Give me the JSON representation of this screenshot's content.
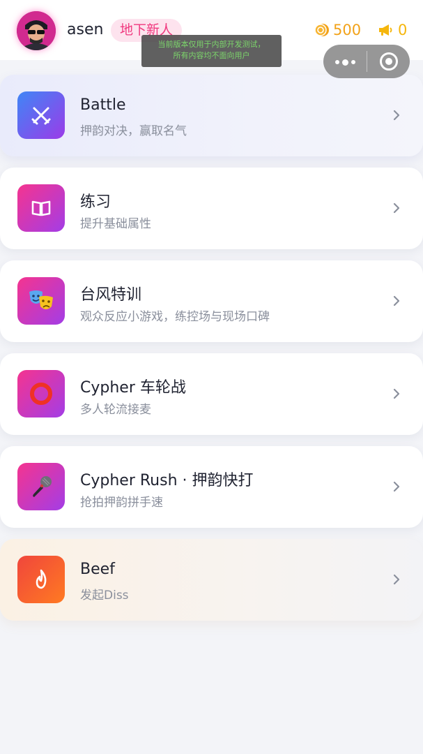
{
  "header": {
    "username": "asen",
    "rank_badge": "地下新人",
    "coins": "500",
    "notifications": "0"
  },
  "dev_notice": {
    "line1": "当前版本仅用于内部开发测试，",
    "line2": "所有内容均不面向用户"
  },
  "menu": [
    {
      "title": "Battle",
      "subtitle": "押韵对决，赢取名气",
      "icon": "crossed-swords-icon",
      "gradient": [
        "#3f86f6",
        "#9b3be8"
      ]
    },
    {
      "title": "练习",
      "subtitle": "提升基础属性",
      "icon": "open-book-icon",
      "gradient": [
        "#f5348f",
        "#a33de6"
      ]
    },
    {
      "title": "台风特训",
      "subtitle": "观众反应小游戏，练控场与现场口碑",
      "icon": "theater-masks-icon",
      "gradient": [
        "#f5348f",
        "#a33de6"
      ]
    },
    {
      "title": "Cypher 车轮战",
      "subtitle": "多人轮流接麦",
      "icon": "red-circle-icon",
      "gradient": [
        "#f5348f",
        "#a33de6"
      ]
    },
    {
      "title": "Cypher Rush · 押韵快打",
      "subtitle": "抢拍押韵拼手速",
      "icon": "microphone-icon",
      "gradient": [
        "#f5348f",
        "#a33de6"
      ]
    },
    {
      "title": "Beef",
      "subtitle": "发起Diss",
      "icon": "flame-icon",
      "gradient": [
        "#f0463c",
        "#ff7a22"
      ]
    }
  ],
  "colors": {
    "rank_badge_text": "#f0397f",
    "coin": "#f2a219",
    "notification": "#f5b60c",
    "chevron": "#8a8f9c"
  }
}
